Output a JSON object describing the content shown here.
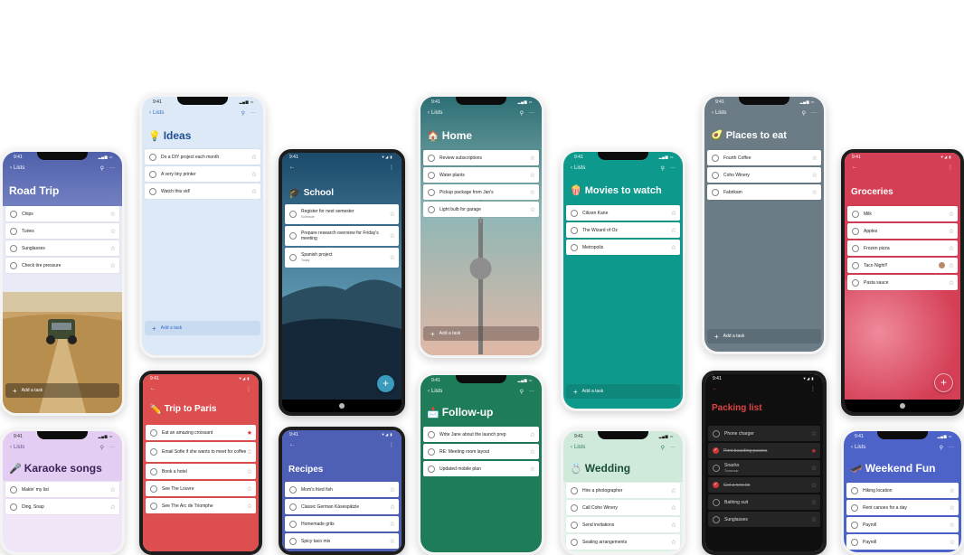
{
  "phones": {
    "road_trip": {
      "time": "9:41",
      "back": "Lists",
      "title": "Road Trip",
      "tasks": [
        "Chips",
        "Turies",
        "Sunglasses",
        "Check tire pressure"
      ],
      "add": "Add a task",
      "color": "#5a6ab0"
    },
    "karaoke": {
      "time": "9:41",
      "back": "Lists",
      "title": "Karaoke songs",
      "emoji": "🎤",
      "tasks": [
        "Makin' my list",
        "Ding, Snap"
      ],
      "color": "#c9a8e4"
    },
    "ideas": {
      "time": "9:41",
      "back": "Lists",
      "title": "Ideas",
      "emoji": "💡",
      "tasks": [
        "Do a DIY project each month",
        "A very tiny printer",
        "Watch this vid!"
      ],
      "add": "Add a task",
      "color": "#dde9f7"
    },
    "trip_paris": {
      "time": "9:41",
      "title": "Trip to Paris",
      "emoji": "✏️",
      "tasks": [
        "Eat an amazing croissant",
        "Email Sofie if she wants to meet for coffee",
        "Book a hotel",
        "See The Louvre",
        "See The Arc de Triomphe"
      ],
      "color": "#dd4f4f"
    },
    "school": {
      "time": "9:41",
      "title": "School",
      "emoji": "🎓",
      "tasks": [
        "Register for next semester",
        "Prepare research overview for Friday's meeting",
        "Spanish project"
      ],
      "subs": [
        "Schedule",
        "",
        "Today"
      ],
      "fab": "+"
    },
    "recipes": {
      "time": "9:41",
      "title": "Recipes",
      "tasks": [
        "Mom's fried fish",
        "Classic German Käsespätzle",
        "Homemade grits",
        "Spicy taco mix"
      ],
      "color": "#4e5fb6"
    },
    "home": {
      "time": "9:41",
      "back": "Lists",
      "title": "Home",
      "emoji": "🏠",
      "tasks": [
        "Review subscriptions",
        "Water plants",
        "Pickup package from Jan's",
        "Light bulb for garage"
      ],
      "add": "Add a task",
      "color": "#2f7378"
    },
    "followup": {
      "time": "9:41",
      "back": "Lists",
      "title": "Follow-up",
      "emoji": "📩",
      "tasks": [
        "Write Jane about the launch prep",
        "RE: Meeting room layout",
        "Updated mobile plan"
      ],
      "color": "#1e7d58"
    },
    "movies": {
      "time": "9:41",
      "back": "Lists",
      "title": "Movies to watch",
      "emoji": "🍿",
      "tasks": [
        "Citizen Kane",
        "The Wizard of Oz",
        "Metropolis"
      ],
      "add": "Add a task",
      "color": "#0d9a8c"
    },
    "wedding": {
      "time": "9:41",
      "back": "Lists",
      "title": "Wedding",
      "emoji": "💍",
      "tasks": [
        "Hire a photographer",
        "Call Coho Winery",
        "Send invitations",
        "Seating arrangements"
      ],
      "color": "#d7efe2"
    },
    "places": {
      "time": "9:41",
      "back": "Lists",
      "title": "Places to eat",
      "emoji": "🥑",
      "tasks": [
        "Fourth Coffee",
        "Coho Winery",
        "Fabrikam"
      ],
      "add": "Add a task",
      "color": "#6b7c86"
    },
    "packing": {
      "time": "9:41",
      "title": "Packing list",
      "tasks": [
        "Phone charger",
        "Print boarding passes",
        "Snacks",
        "Get a new tie",
        "Bathing suit",
        "Sunglasses"
      ],
      "subs": [
        "",
        "",
        "Tomorrow",
        "",
        "",
        ""
      ],
      "color": "#e04444"
    },
    "groceries": {
      "time": "9:41",
      "title": "Groceries",
      "tasks": [
        "Milk",
        "Apples",
        "Frozen pizza",
        "Taco Night!!",
        "Pasta sauce"
      ],
      "fab": "+",
      "color": "#d43f56"
    },
    "weekend": {
      "time": "9:41",
      "back": "Lists",
      "title": "Weekend Fun",
      "emoji": "🛹",
      "tasks": [
        "Hiking location",
        "Rent canoes for a day",
        "Payroll",
        "Payroll"
      ],
      "color": "#4d63c8"
    }
  },
  "icons": {
    "back": "chevron-left-icon",
    "share": "person-add-icon",
    "more": "more-icon",
    "star": "star-icon",
    "plus": "plus-icon"
  }
}
